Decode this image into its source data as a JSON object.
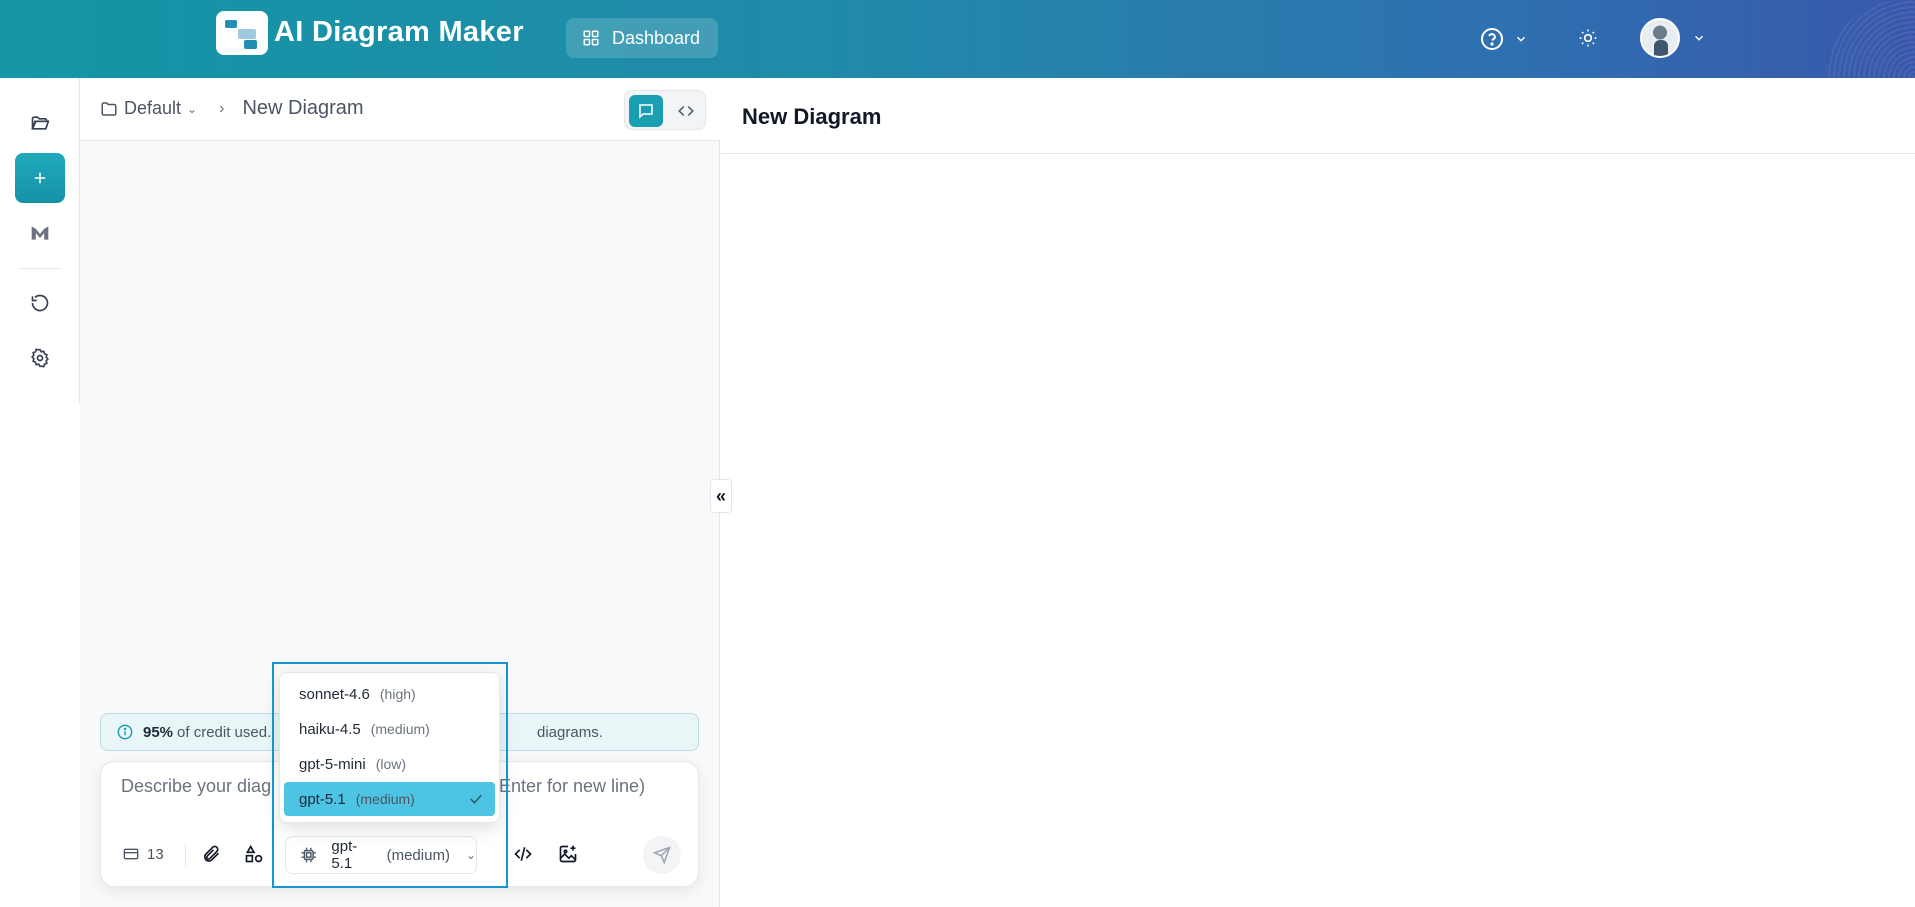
{
  "header": {
    "brand": "AI Diagram Maker",
    "dashboard_label": "Dashboard"
  },
  "breadcrumb": {
    "folder": "Default",
    "separator": "›",
    "diagram": "New Diagram"
  },
  "credit": {
    "percent": "95%",
    "text": "of credit used.",
    "tail": "diagrams."
  },
  "composer": {
    "placeholder_start": "Describe your diag",
    "placeholder_end": "Enter for new line)",
    "count": "13",
    "model_name": "gpt-5.1",
    "model_effort": "(medium)"
  },
  "model_options": [
    {
      "name": "sonnet-4.6",
      "effort": "(high)"
    },
    {
      "name": "haiku-4.5",
      "effort": "(medium)"
    },
    {
      "name": "gpt-5-mini",
      "effort": "(low)"
    },
    {
      "name": "gpt-5.1",
      "effort": "(medium)",
      "selected": true
    }
  ],
  "right_panel": {
    "title": "New Diagram",
    "collapse_glyph": "«"
  },
  "colors": {
    "accent": "#1a9fb0",
    "selected_option": "#4ec4e4",
    "focus_outline": "#1595d0"
  }
}
